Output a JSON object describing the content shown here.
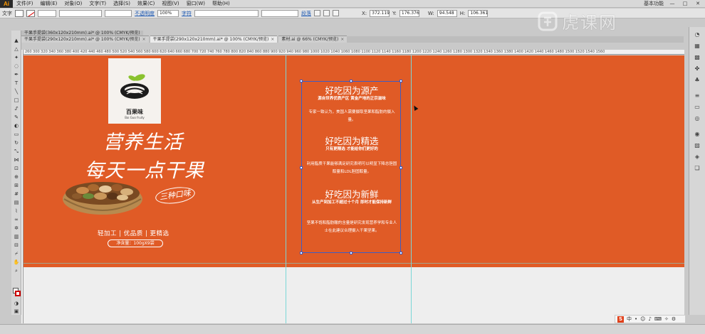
{
  "menu": {
    "app_logo": "Ai",
    "items": [
      "文件(F)",
      "编辑(E)",
      "对象(O)",
      "文字(T)",
      "选择(S)",
      "效果(C)",
      "视图(V)",
      "窗口(W)",
      "帮助(H)"
    ],
    "workspace": "基本功能",
    "window_buttons": [
      "—",
      "□",
      "✕"
    ]
  },
  "control": {
    "tool_label": "文字",
    "opacity_label": "不透明度",
    "opacity_value": "100%",
    "char_label": "字符",
    "para_label": "段落",
    "x_value": "372.119",
    "y_value": "176.376",
    "w_value": "94.548",
    "h_value": "106.361"
  },
  "tabs": {
    "top": "干果手提袋(360x120x210mm).ai* @ 100% (CMYK/预览)",
    "items": [
      {
        "label": "干果手提袋(290x120x210mm).ai* @ 100% (CMYK/预览)",
        "active": false
      },
      {
        "label": "干果手提袋(290x120x210mm).ai* @ 100% (CMYK/预览)",
        "active": true
      },
      {
        "label": "素材.ai @ 66% (CMYK/预览)",
        "active": false
      }
    ]
  },
  "ruler": {
    "numbers": "260 300 320 340 360 380 400 420 440 460 480 500 520 540 560 580 600 620 640 660 680 700 720 740 760 780 800 820 840 860 880 900 920 940 960 980 1000 1020 1040 1060 1080 1100 1120 1140 1160 1180 1200 1220 1240 1260 1280 1300 1320 1340 1360 1380 1400 1420 1440 1460 1480 1500 1520 1540 1560"
  },
  "artboard": {
    "background": "#e05b26",
    "brand": {
      "name": "百果味",
      "sub": "Bai Guo fruity"
    },
    "slogan_line1": "营养生活",
    "slogan_line2": "每天一点干果",
    "flavor_badge": "三种口味",
    "features": "轻加工 | 优品质 | 更精选",
    "net_weight": "净含量：100gX9袋",
    "sections": [
      {
        "title": "好吃因为源产",
        "subtitle": "源自世界优质产区 黄金产地的正宗滋味",
        "body": "专家一致认为，美国人需要摄取坚果和脂肪的摄入量。"
      },
      {
        "title": "好吃因为精选",
        "subtitle": "只有更精选 才能给你们更好的",
        "body": "利用脂质干果能够满足研究表明可以明显下降总胆固醇量和LDL胆固醇量。"
      },
      {
        "title": "好吃因为新鲜",
        "subtitle": "从生产到加工不超过十个月 即时才能保持新鲜",
        "body": "坚果不饱和脂肪酸的含量是研究发现营养学和专业人士在此建议合理摄入干果坚果。"
      }
    ]
  },
  "watermark": {
    "text": "虎课网"
  },
  "tray": {
    "brand": "S",
    "input_mode": "中"
  },
  "colors": {
    "accent": "#e05b26",
    "guide": "#7bd7d7",
    "selection": "#3d5cc4"
  }
}
